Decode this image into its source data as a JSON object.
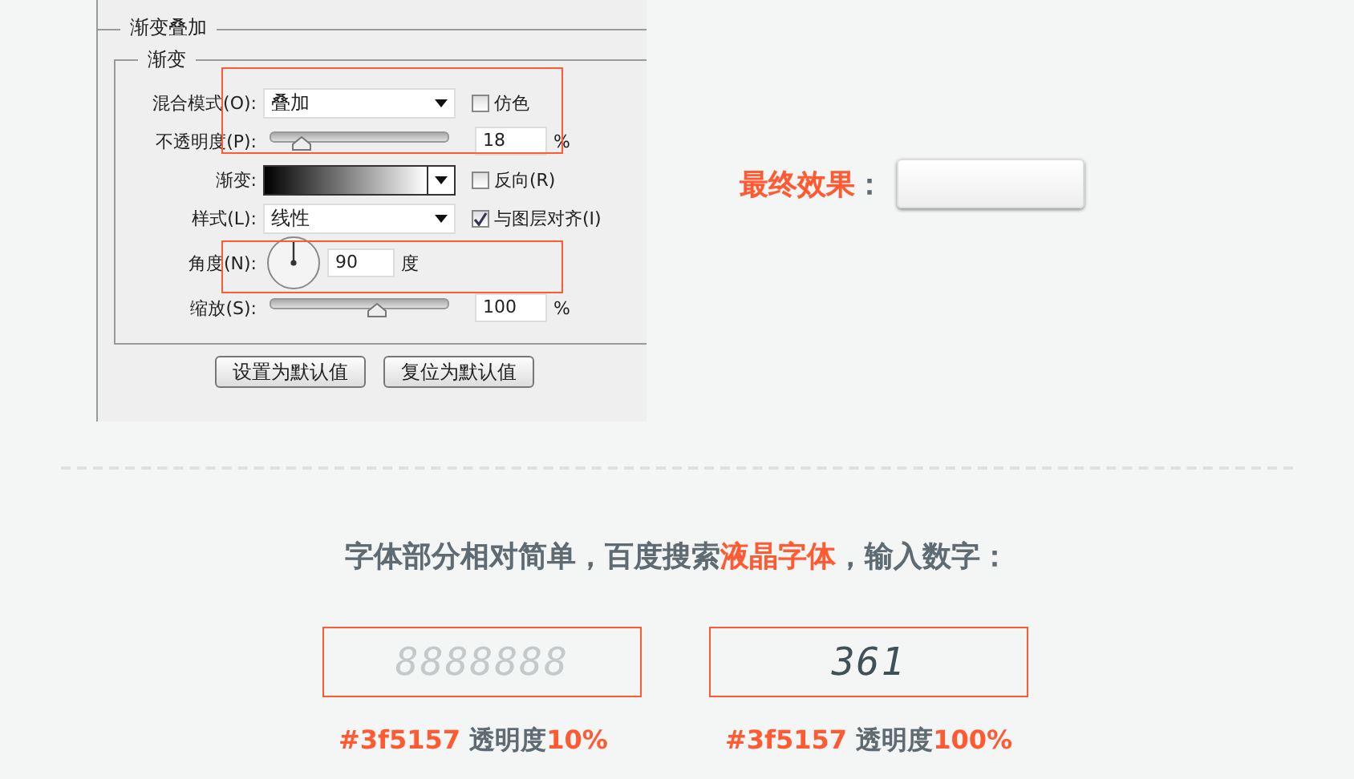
{
  "dialog": {
    "title": "渐变叠加",
    "group_title": "渐变",
    "blend_mode": {
      "label": "混合模式(O):",
      "value": "叠加"
    },
    "dither": {
      "label": "仿色",
      "checked": false
    },
    "opacity": {
      "label": "不透明度(P):",
      "level": 0.18,
      "value": "18",
      "unit": "%"
    },
    "gradient": {
      "label": "渐变:"
    },
    "reverse": {
      "label": "反向(R)",
      "checked": false
    },
    "style": {
      "label": "样式(L):",
      "value": "线性"
    },
    "align": {
      "label": "与图层对齐(I)",
      "checked": true
    },
    "angle": {
      "label": "角度(N):",
      "value": "90",
      "unit": "度"
    },
    "scale": {
      "label": "缩放(S):",
      "level": 0.6,
      "value": "100",
      "unit": "%"
    },
    "buttons": [
      "设置为默认值",
      "复位为默认值"
    ]
  },
  "result": {
    "label": [
      {
        "text": "最终效果",
        "highlight": true
      },
      {
        "text": "：",
        "highlight": false
      }
    ]
  },
  "heading": [
    {
      "text": "字体部分相对简单，百度搜索",
      "highlight": false
    },
    {
      "text": "液晶字体",
      "highlight": true
    },
    {
      "text": "，输入数字：",
      "highlight": false
    }
  ],
  "displays": [
    {
      "digits": "8888888",
      "faded": true,
      "caption": [
        {
          "text": "#3f5157",
          "highlight": true
        },
        {
          "text": " 透明度",
          "highlight": false
        },
        {
          "text": "10%",
          "highlight": true
        }
      ]
    },
    {
      "digits": "361",
      "faded": false,
      "caption": [
        {
          "text": "#3f5157",
          "highlight": true
        },
        {
          "text": " 透明度",
          "highlight": false
        },
        {
          "text": "100%",
          "highlight": true
        }
      ]
    }
  ]
}
